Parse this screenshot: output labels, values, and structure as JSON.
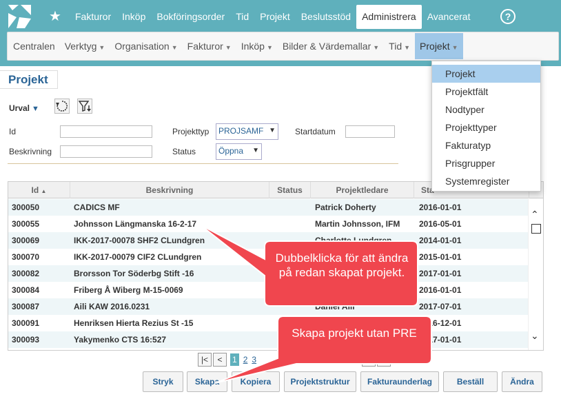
{
  "topnav": {
    "items": [
      "Fakturor",
      "Inköp",
      "Bokföringsorder",
      "Tid",
      "Projekt",
      "Beslutsstöd",
      "Administrera",
      "Avancerat"
    ],
    "active": "Administrera",
    "help": "?"
  },
  "subnav": {
    "items": [
      "Centralen",
      "Verktyg",
      "Organisation",
      "Fakturor",
      "Inköp",
      "Bilder & Värdemallar",
      "Tid",
      "Projekt"
    ],
    "active": "Projekt"
  },
  "page_title": "Projekt",
  "filter": {
    "urval": "Urval",
    "id_label": "Id",
    "id_value": "",
    "beskrivning_label": "Beskrivning",
    "beskrivning_value": "",
    "projekttyp_label": "Projekttyp",
    "projekttyp_value": "PROJSAMF",
    "status_label": "Status",
    "status_value": "Öppna",
    "startdatum_label": "Startdatum",
    "startdatum_value": ""
  },
  "grid": {
    "columns": [
      "Id",
      "Beskrivning",
      "Status",
      "Projektledare",
      "Sta"
    ],
    "rows": [
      [
        "300050",
        "CADICS MF",
        "",
        "Patrick Doherty",
        "2016-01-01"
      ],
      [
        "300055",
        "Johnsson Längmanska 16-2-17",
        "",
        "Martin Johnsson, IFM",
        "2016-05-01"
      ],
      [
        "300069",
        "IKK-2017-00078 SHF2 CLundgren",
        "",
        "Charlotte Lundgren",
        "2014-01-01"
      ],
      [
        "300070",
        "IKK-2017-00079 CIF2 CLundgren",
        "",
        "",
        "2015-01-01"
      ],
      [
        "300082",
        "Brorsson Tor Söderbg Stift -16",
        "",
        "",
        "2017-01-01"
      ],
      [
        "300084",
        "Friberg Å Wiberg M-15-0069",
        "",
        "",
        "2016-01-01"
      ],
      [
        "300087",
        "Aili KAW 2016.0231",
        "",
        "Daniel Aili",
        "2017-07-01"
      ],
      [
        "300091",
        "Henriksen Hierta Rezius St -15",
        "",
        "",
        "2016-12-01"
      ],
      [
        "300093",
        "Yakymenko CTS 16:527",
        "",
        "",
        "2017-01-01"
      ]
    ]
  },
  "pager": {
    "pages": [
      "1",
      "2",
      "3"
    ],
    "current": "1"
  },
  "actions": [
    "Stryk",
    "Skapa",
    "Kopiera",
    "Projektstruktur",
    "Fakturaunderlag",
    "Beställ",
    "Ändra"
  ],
  "dropdown": {
    "items": [
      "Projekt",
      "Projektfält",
      "Nodtyper",
      "Projekttyper",
      "Fakturatyp",
      "Prisgrupper",
      "Systemregister"
    ],
    "selected": "Projekt"
  },
  "callouts": {
    "first": "Dubbelklicka för att ändra på redan skapat projekt.",
    "second": "Skapa projekt utan PRE"
  },
  "colors": {
    "header": "#5fb0bc",
    "callout": "#f0464e",
    "link": "#2a6496",
    "row_alt": "#eef6f8"
  }
}
